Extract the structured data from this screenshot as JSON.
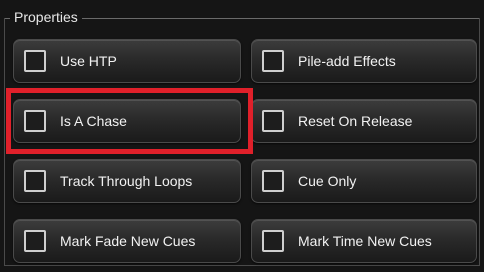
{
  "group": {
    "title": "Properties"
  },
  "properties": [
    {
      "label": "Use HTP",
      "checked": false
    },
    {
      "label": "Pile-add Effects",
      "checked": false
    },
    {
      "label": "Is A Chase",
      "checked": false
    },
    {
      "label": "Reset On Release",
      "checked": false
    },
    {
      "label": "Track Through Loops",
      "checked": false
    },
    {
      "label": "Cue Only",
      "checked": false
    },
    {
      "label": "Mark Fade New Cues",
      "checked": false
    },
    {
      "label": "Mark Time New Cues",
      "checked": false
    }
  ],
  "colors": {
    "highlight": "#e0202a"
  }
}
